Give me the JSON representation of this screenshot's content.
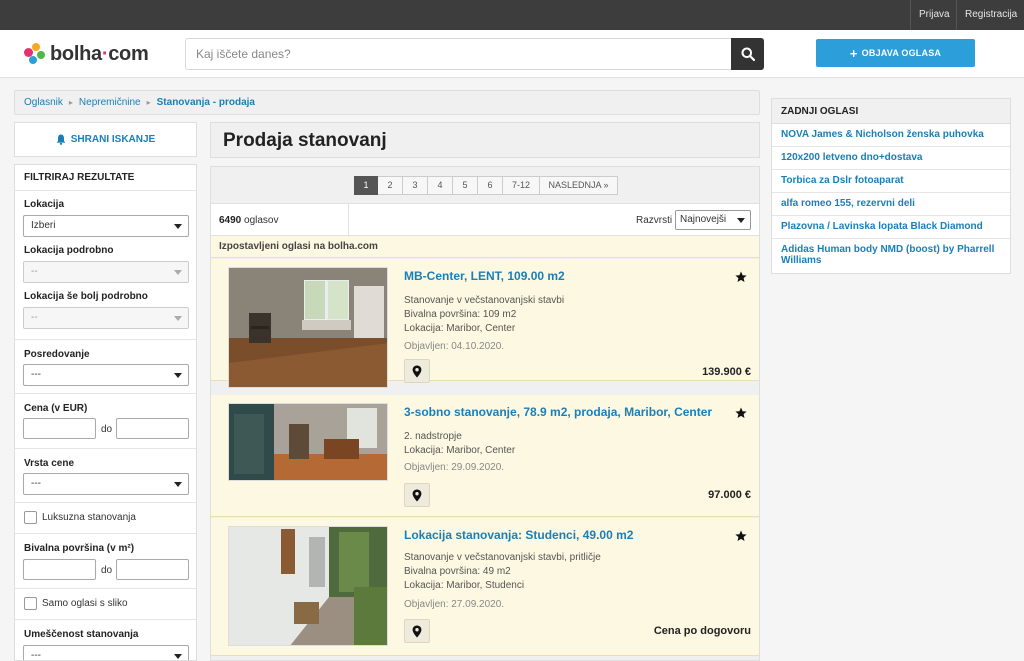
{
  "topbar": {
    "login": "Prijava",
    "register": "Registracija"
  },
  "header": {
    "logo_text": "bolha",
    "logo_dot": "·",
    "logo_tld": "com",
    "search_placeholder": "Kaj iščete danes?",
    "post_button": "OBJAVA OGLASA"
  },
  "colors": {
    "accent": "#2c9fda",
    "link": "#1a7fb8",
    "featured_bg": "#fdf8e1",
    "topbar": "#3d3d3d"
  },
  "breadcrumb": {
    "items": [
      "Oglasnik",
      "Nepremičnine"
    ],
    "current": "Stanovanja - prodaja"
  },
  "sidebar": {
    "save_search": "SHRANI ISKANJE",
    "filters_title": "FILTRIRAJ REZULTATE",
    "location_label": "Lokacija",
    "location_value": "Izberi",
    "location_detail_label": "Lokacija podrobno",
    "location_detail_value": "--",
    "location_more_label": "Lokacija še bolj podrobno",
    "location_more_value": "--",
    "agency_label": "Posredovanje",
    "agency_value": "---",
    "price_label": "Cena (v EUR)",
    "range_sep": "do",
    "price_type_label": "Vrsta cene",
    "price_type_value": "---",
    "luxury_label": "Luksuzna stanovanja",
    "area_label": "Bivalna površina (v m²)",
    "with_image_label": "Samo oglasi s sliko",
    "furnished_label": "Umeščenost stanovanja",
    "furnished_value": "---"
  },
  "main": {
    "title": "Prodaja stanovanj",
    "pagination": [
      "1",
      "2",
      "3",
      "4",
      "5",
      "6",
      "7-12",
      "NASLEDNJA »"
    ],
    "count_number": "6490",
    "count_suffix": " oglasov",
    "sort_label": "Razvrsti",
    "sort_value": "Najnovejši",
    "featured_heading": "Izpostavljeni oglasi na bolha.com",
    "listings": [
      {
        "title": "MB-Center, LENT, 109.00 m2",
        "lines": [
          "Stanovanje v večstanovanjski stavbi",
          "Bivalna površina: 109 m2",
          "Lokacija: Maribor, Center"
        ],
        "date": "Objavljen: 04.10.2020.",
        "price": "139.900 €"
      },
      {
        "title": "3-sobno stanovanje, 78.9 m2, prodaja, Maribor, Center",
        "lines": [
          "2. nadstropje",
          "Lokacija: Maribor, Center"
        ],
        "date": "Objavljen: 29.09.2020.",
        "price": "97.000 €"
      },
      {
        "title": "Lokacija stanovanja: Studenci, 49.00 m2",
        "lines": [
          "Stanovanje v večstanovanjski stavbi, pritličje",
          "Bivalna površina: 49 m2",
          "Lokacija: Maribor, Studenci"
        ],
        "date": "Objavljen: 27.09.2020.",
        "price": "Cena po dogovoru"
      }
    ]
  },
  "latest": {
    "title": "ZADNJI OGLASI",
    "items": [
      "NOVA James & Nicholson ženska puhovka",
      "120x200 letveno dno+dostava",
      "Torbica za Dslr fotoaparat",
      "alfa romeo 155, rezervni deli",
      "Plazovna / Lavinska lopata Black Diamond",
      "Adidas Human body NMD (boost) by Pharrell Williams"
    ]
  }
}
